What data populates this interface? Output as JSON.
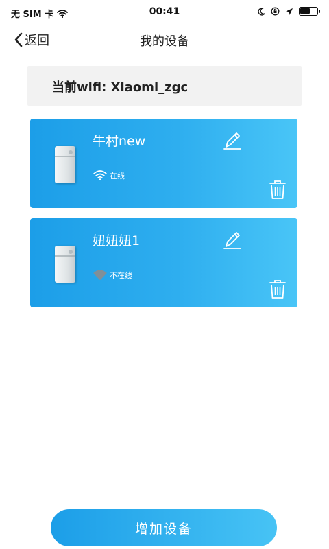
{
  "status_bar": {
    "carrier": "无 SIM 卡",
    "time": "00:41",
    "battery_level": 0.6
  },
  "nav": {
    "back_label": "返回",
    "title": "我的设备"
  },
  "current_wifi": {
    "label": "当前wifi:",
    "ssid": "Xiaomi_zgc"
  },
  "devices": [
    {
      "name": "牛村new",
      "status": "在线",
      "online": true
    },
    {
      "name": "妞妞妞1",
      "status": "不在线",
      "online": false
    }
  ],
  "add_button_label": "增加设备",
  "colors": {
    "card_start": "#1c9ee8",
    "card_end": "#49c5f7",
    "offline_wifi": "#7f8f99",
    "wifi_bar_bg": "#f2f2f2"
  },
  "icons": {
    "back": "chevron-left-icon",
    "edit": "pencil-icon",
    "delete": "trash-icon",
    "online": "wifi-icon",
    "offline": "wifi-off-icon"
  }
}
